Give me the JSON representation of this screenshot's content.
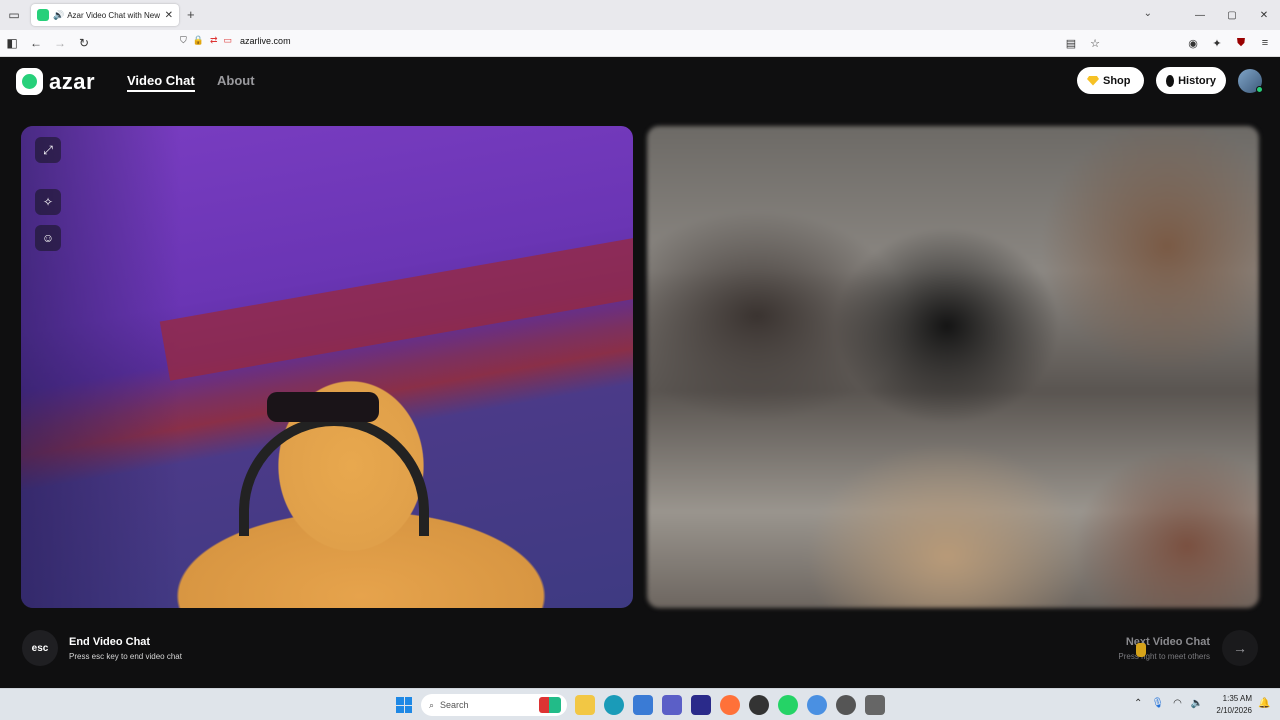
{
  "browser": {
    "tab_title": "Azar Video Chat with New",
    "url": "azarlive.com",
    "new_tab": "+",
    "tab_close": "✕"
  },
  "header": {
    "logo_text": "azar",
    "nav": {
      "video_chat": "Video Chat",
      "about": "About"
    },
    "shop_label": "Shop",
    "history_label": "History"
  },
  "controls": {
    "esc_label": "esc",
    "end_title": "End Video Chat",
    "end_sub": "Press esc key to end video chat",
    "next_title": "Next Video Chat",
    "next_sub": "Press right  to meet others",
    "next_arrow": "→"
  },
  "taskbar": {
    "search_placeholder": "Search",
    "time": "1:35 AM",
    "date": "2/10/2026"
  },
  "colors": {
    "brand": "#27d07a",
    "background": "#0f0f10"
  },
  "icons": {
    "tools": [
      "expand-icon",
      "magic-wand-icon",
      "sticker-face-icon"
    ]
  }
}
